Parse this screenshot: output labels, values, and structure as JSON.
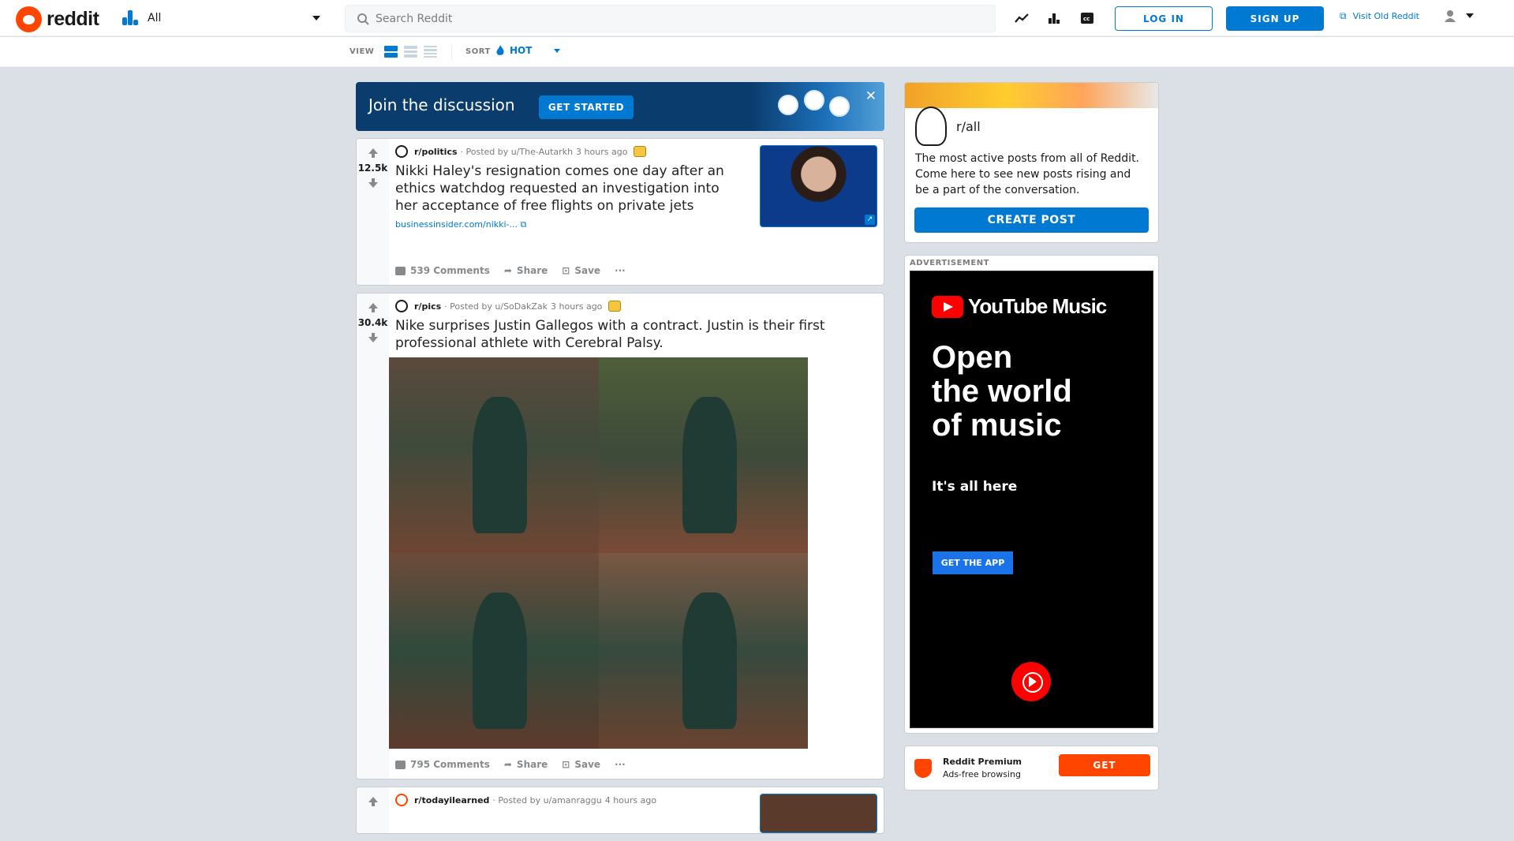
{
  "header": {
    "logo_text": "reddit",
    "feed_label": "All",
    "search_placeholder": "Search Reddit",
    "login_label": "LOG IN",
    "signup_label": "SIGN UP",
    "old_reddit_label": "Visit Old Reddit"
  },
  "subbar": {
    "view_label": "VIEW",
    "sort_label": "SORT",
    "sort_value": "HOT"
  },
  "banner": {
    "title": "Join the discussion",
    "button": "GET STARTED"
  },
  "posts": [
    {
      "score": "12.5k",
      "subreddit": "r/politics",
      "posted_by": "· Posted by u/The-Autarkh",
      "time": "3 hours ago",
      "title": "Nikki Haley's resignation comes one day after an ethics watchdog requested an investigation into her acceptance of free flights on private jets",
      "link": "businessinsider.com/nikki-...",
      "comments": "539 Comments",
      "share": "Share",
      "save": "Save",
      "more": "···"
    },
    {
      "score": "30.4k",
      "subreddit": "r/pics",
      "posted_by": "· Posted by u/SoDakZak",
      "time": "3 hours ago",
      "title": "Nike surprises Justin Gallegos with a contract. Justin is their first professional athlete with Cerebral Palsy.",
      "comments": "795 Comments",
      "share": "Share",
      "save": "Save",
      "more": "···"
    },
    {
      "subreddit": "r/todayilearned",
      "posted_by": "· Posted by u/amanraggu",
      "time": "4 hours ago"
    }
  ],
  "sidebar": {
    "name": "r/all",
    "description": "The most active posts from all of Reddit. Come here to see new posts rising and be a part of the conversation.",
    "create_post": "CREATE POST",
    "ad_label": "ADVERTISEMENT",
    "ad_brand": "YouTube Music",
    "ad_headline_1": "Open",
    "ad_headline_2": "the world",
    "ad_headline_3": "of music",
    "ad_sub": "It's all here",
    "ad_button": "GET THE APP",
    "premium_title": "Reddit Premium",
    "premium_sub": "Ads-free browsing",
    "premium_button": "GET"
  },
  "colors": {
    "accent": "#0079d3",
    "brand": "#ff4500",
    "background": "#dae0e6"
  }
}
